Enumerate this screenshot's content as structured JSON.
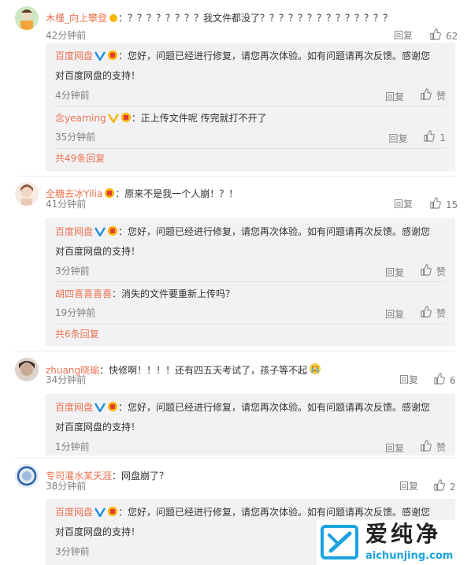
{
  "comments": [
    {
      "user": "木槿_向上攀登",
      "text": "？？？？？？？？我文件都没了？？？？？？？？？？？？？？",
      "time": "42分钟前",
      "reply_label": "回复",
      "likes": "62",
      "replies": [
        {
          "user": "百度网盘",
          "text": "您好，问题已经进行修复，请您再次体验。如有问题请再次反馈。感谢您",
          "text2": "对百度网盘的支持！",
          "time": "4分钟前",
          "reply_label": "回复",
          "likes": "赞"
        },
        {
          "user": "念yearning",
          "text": "正上传文件呢 传完就打不开了",
          "time": "35分钟前",
          "reply_label": "回复",
          "likes": "1"
        }
      ],
      "more": "共49条回复"
    },
    {
      "user": "全糖去冰Yilia",
      "text": "原来不是我一个人崩！？！",
      "time": "41分钟前",
      "reply_label": "回复",
      "likes": "15",
      "replies": [
        {
          "user": "百度网盘",
          "text": "您好，问题已经进行修复，请您再次体验。如有问题请再次反馈。感谢您",
          "text2": "对百度网盘的支持！",
          "time": "3分钟前",
          "reply_label": "回复",
          "likes": "赞"
        },
        {
          "user": "胡四喜喜喜喜",
          "text": "消失的文件要重新上传吗？",
          "time": "19分钟前",
          "reply_label": "回复",
          "likes": "赞"
        }
      ],
      "more": "共6条回复"
    },
    {
      "user": "zhuang晓瑜",
      "text": "快修啊！！！！还有四五天考试了，孩子等不起",
      "time": "34分钟前",
      "reply_label": "回复",
      "likes": "6",
      "replies": [
        {
          "user": "百度网盘",
          "text": "您好，问题已经进行修复，请您再次体验。如有问题请再次反馈。感谢您",
          "text2": "对百度网盘的支持！",
          "time": "1分钟前",
          "reply_label": "回复",
          "likes": "赞"
        }
      ]
    },
    {
      "user": "专司灌水某天涯",
      "text": "网盘崩了？",
      "time": "38分钟前",
      "reply_label": "回复",
      "likes": "2",
      "replies": [
        {
          "user": "百度网盘",
          "text": "您好，问题已经进行修复，请您再次体验。如有问题请再次反馈。感谢您",
          "text2": "对百度网盘的支持！",
          "time": "3分钟前"
        }
      ]
    }
  ],
  "watermark": {
    "brand": "爱纯净",
    "url": "aichunjing.com"
  },
  "colors": {
    "username": "#eb7350",
    "meta": "#808080",
    "reply_bg": "#f2f2f5",
    "verified": "#f7b500",
    "watermark": "#1aa3e0"
  }
}
